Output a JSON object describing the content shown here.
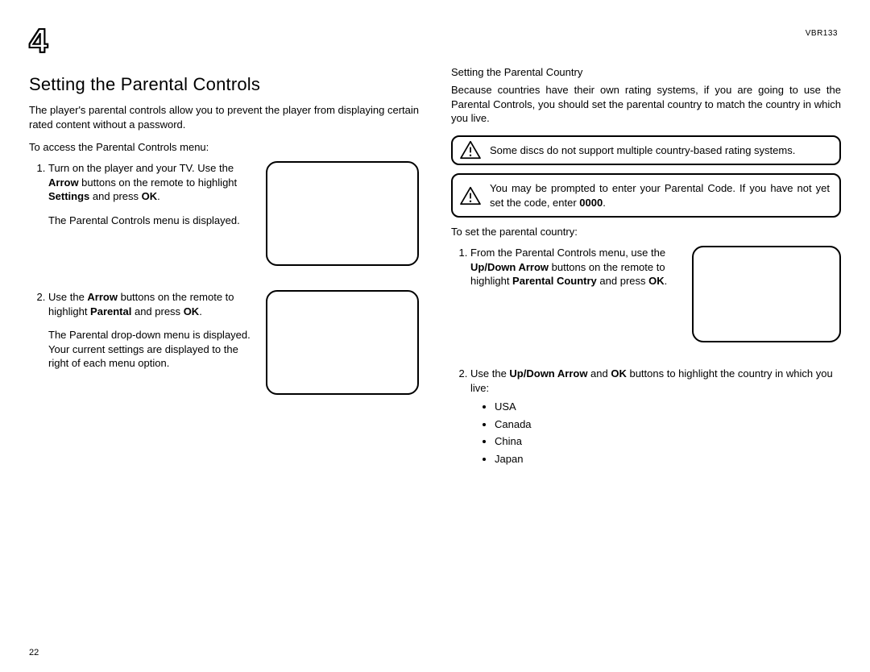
{
  "chapter_number": "4",
  "model": "VBR133",
  "page_number": "22",
  "left": {
    "heading": "Setting the Parental Controls",
    "intro": "The player's parental controls allow you to prevent the player from displaying certain rated content without a password.",
    "access": "To access the Parental Controls menu:",
    "step1": {
      "a": "Turn on the player and your TV. Use the ",
      "b_arrow": "Arrow",
      "c": " buttons on the remote to highlight ",
      "b_settings": "Settings",
      "d": " and press ",
      "b_ok": "OK",
      "e": ".",
      "result": "The Parental Controls menu is displayed."
    },
    "step2": {
      "a": "Use the ",
      "b_arrow": "Arrow",
      "c": " buttons on the remote to highlight ",
      "b_parental": "Parental",
      "d": " and press ",
      "b_ok": "OK",
      "e": ".",
      "result": "The Parental drop-down menu is displayed. Your current settings are displayed to the right of each menu option."
    }
  },
  "right": {
    "heading": "Setting the Parental Country",
    "intro": "Because countries have their own rating systems, if you are going to use the Parental Controls, you should set the parental country to match the country in which you live.",
    "note1": "Some discs do not support multiple country-based rating systems.",
    "note2": {
      "a": "You may be prompted to enter your Parental Code. If you have not yet set the code, enter ",
      "b_code": "0000",
      "c": "."
    },
    "lead": "To set the parental country:",
    "step1": {
      "a": "From the Parental Controls menu, use the ",
      "b_ud": "Up/Down Arrow",
      "c": " buttons on the remote to highlight ",
      "b_pc": "Parental Country",
      "d": " and press ",
      "b_ok": "OK",
      "e": "."
    },
    "step2": {
      "a": "Use the ",
      "b_ud": "Up/Down Arrow",
      "c": " and ",
      "b_ok": "OK",
      "d": " buttons to highlight the country in which you live:"
    },
    "countries": [
      "USA",
      "Canada",
      "China",
      "Japan"
    ]
  }
}
